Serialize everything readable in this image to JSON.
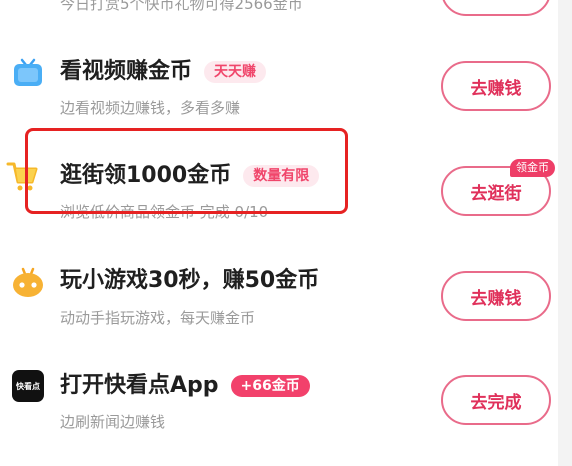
{
  "top_partial": {
    "desc": "今日打赏5个快币礼物可得2566金币"
  },
  "tasks": [
    {
      "icon": "tv-icon",
      "title": "看视频赚金币",
      "tag": "天天赚",
      "desc": "边看视频边赚钱，多看多赚",
      "button": "去赚钱"
    },
    {
      "icon": "shopping-cart-icon",
      "title": "逛街领1000金币",
      "tag": "数量有限",
      "desc": "浏览低价商品领金币 完成 0/10",
      "button": "去逛街",
      "ribbon": "领金币"
    },
    {
      "icon": "game-controller-icon",
      "title": "玩小游戏30秒，赚50金币",
      "desc": "动动手指玩游戏，每天赚金币",
      "button": "去赚钱"
    },
    {
      "icon": "kuaikandian-app-icon",
      "icon_text": "快看点",
      "title": "打开快看点App",
      "tag": "+66金币",
      "desc": "边刷新闻边赚钱",
      "button": "去完成"
    }
  ],
  "colors": {
    "accent": "#e0315b",
    "button_border": "#e96b8a",
    "tag_bg": "#fde9ee",
    "highlight": "#e62222"
  }
}
